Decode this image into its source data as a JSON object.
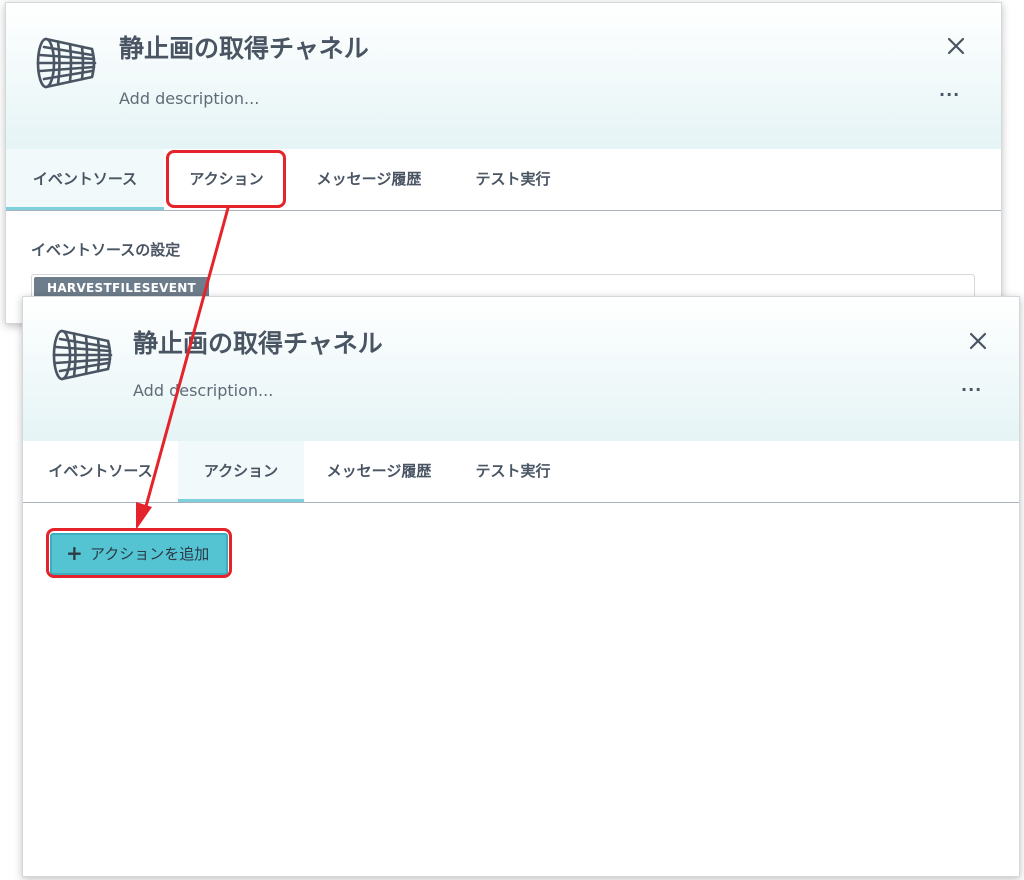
{
  "back_panel": {
    "title": "静止画の取得チャネル",
    "description_placeholder": "Add description...",
    "tabs": [
      "イベントソース",
      "アクション",
      "メッセージ履歴",
      "テスト実行"
    ],
    "active_tab": "イベントソース",
    "section_label": "イベントソースの設定",
    "event_source_tag": "HARVESTFILESEVENT"
  },
  "front_panel": {
    "title": "静止画の取得チャネル",
    "description_placeholder": "Add description...",
    "tabs": [
      "イベントソース",
      "アクション",
      "メッセージ履歴",
      "テスト実行"
    ],
    "active_tab": "アクション",
    "add_action_plus": "+",
    "add_action_label": "アクションを追加"
  },
  "icons": {
    "channel": "net-icon",
    "close": "close-icon",
    "more": "more-icon"
  },
  "colors": {
    "accent": "#54c4d3",
    "active_tab_underline": "#7ed1da",
    "annotation": "#e5232a",
    "tag_chip": "#6e7d8b",
    "text": "#4a5563"
  },
  "more_glyph": "···",
  "close_glyph": "✕"
}
